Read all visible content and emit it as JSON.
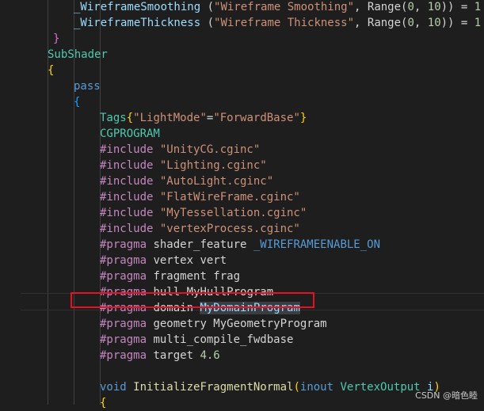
{
  "colors": {
    "background": "#1e1e1e",
    "default_text": "#d4d4d4",
    "identifier": "#9cdcfe",
    "string": "#ce9178",
    "keyword_blue": "#569cd6",
    "control_purple": "#c586c0",
    "function_yellow": "#dcdcaa",
    "number_green": "#b5cea8",
    "teal_type": "#4ec9b0",
    "bracket_gold": "#ffd700",
    "bracket_pink": "#da70d6",
    "bracket_blue": "#179fff",
    "highlight_border": "#e81123"
  },
  "code": {
    "lines": [
      [
        [
          "_WireframeSmoothing ",
          "ident"
        ],
        [
          "(",
          "punc"
        ],
        [
          "\"Wireframe Smoothing\"",
          "str"
        ],
        [
          ", Range(",
          "punc"
        ],
        [
          "0",
          "num"
        ],
        [
          ", ",
          "punc"
        ],
        [
          "10",
          "num"
        ],
        [
          ")) = ",
          "punc"
        ],
        [
          "1",
          "num"
        ]
      ],
      [
        [
          "_WireframeThickness ",
          "ident"
        ],
        [
          "(",
          "punc"
        ],
        [
          "\"Wireframe Thickness\"",
          "str"
        ],
        [
          ", Range(",
          "punc"
        ],
        [
          "0",
          "num"
        ],
        [
          ", ",
          "punc"
        ],
        [
          "10",
          "num"
        ],
        [
          ")) = ",
          "punc"
        ],
        [
          "1",
          "num"
        ]
      ],
      [
        [
          "}",
          "bpink"
        ]
      ],
      [
        [
          "SubShader",
          "teal"
        ]
      ],
      [
        [
          "{",
          "bgold"
        ]
      ],
      [
        [
          "pass",
          "kw"
        ]
      ],
      [
        [
          "{",
          "bblue"
        ]
      ],
      [
        [
          "Tags",
          "teal"
        ],
        [
          "{",
          "bgold"
        ],
        [
          "\"LightMode\"",
          "str"
        ],
        [
          "=",
          "punc"
        ],
        [
          "\"ForwardBase\"",
          "str"
        ],
        [
          "}",
          "bgold"
        ]
      ],
      [
        [
          "CGPROGRAM",
          "teal"
        ]
      ],
      [
        [
          "#include ",
          "ctrl"
        ],
        [
          "\"UnityCG.cginc\"",
          "str"
        ]
      ],
      [
        [
          "#include ",
          "ctrl"
        ],
        [
          "\"Lighting.cginc\"",
          "str"
        ]
      ],
      [
        [
          "#include ",
          "ctrl"
        ],
        [
          "\"AutoLight.cginc\"",
          "str"
        ]
      ],
      [
        [
          "#include ",
          "ctrl"
        ],
        [
          "\"FlatWireFrame.cginc\"",
          "str"
        ]
      ],
      [
        [
          "#include ",
          "ctrl"
        ],
        [
          "\"MyTessellation.cginc\"",
          "str"
        ]
      ],
      [
        [
          "#include ",
          "ctrl"
        ],
        [
          "\"vertexProcess.cginc\"",
          "str"
        ]
      ],
      [
        [
          "#pragma ",
          "ctrl"
        ],
        [
          "shader_feature ",
          "punc"
        ],
        [
          "_WIREFRAMEENABLE_ON",
          "kw"
        ]
      ],
      [
        [
          "#pragma ",
          "ctrl"
        ],
        [
          "vertex vert",
          "punc"
        ]
      ],
      [
        [
          "#pragma ",
          "ctrl"
        ],
        [
          "fragment frag",
          "punc"
        ]
      ],
      [
        [
          "#pragma ",
          "ctrl"
        ],
        [
          "hull MyHullProgram",
          "punc"
        ]
      ],
      [
        [
          "#pragma ",
          "ctrl"
        ],
        [
          "domain ",
          "punc"
        ],
        [
          "MyDomainProgram",
          "sel"
        ]
      ],
      [
        [
          "#pragma ",
          "ctrl"
        ],
        [
          "geometry MyGeometryProgram",
          "punc"
        ]
      ],
      [
        [
          "#pragma ",
          "ctrl"
        ],
        [
          "multi_compile_fwdbase",
          "punc"
        ]
      ],
      [
        [
          "#pragma ",
          "ctrl"
        ],
        [
          "target ",
          "punc"
        ],
        [
          "4.6",
          "num"
        ]
      ],
      [
        [
          "",
          "punc"
        ]
      ],
      [
        [
          "void ",
          "kw"
        ],
        [
          "InitializeFragmentNormal",
          "fn"
        ],
        [
          "(",
          "bgold"
        ],
        [
          "inout ",
          "kw"
        ],
        [
          "VertexOutput ",
          "teal"
        ],
        [
          "i",
          "ident"
        ],
        [
          ")",
          "bgold"
        ]
      ],
      [
        [
          "{",
          "bgold"
        ]
      ]
    ]
  },
  "watermark": "CSDN @暗色睦"
}
